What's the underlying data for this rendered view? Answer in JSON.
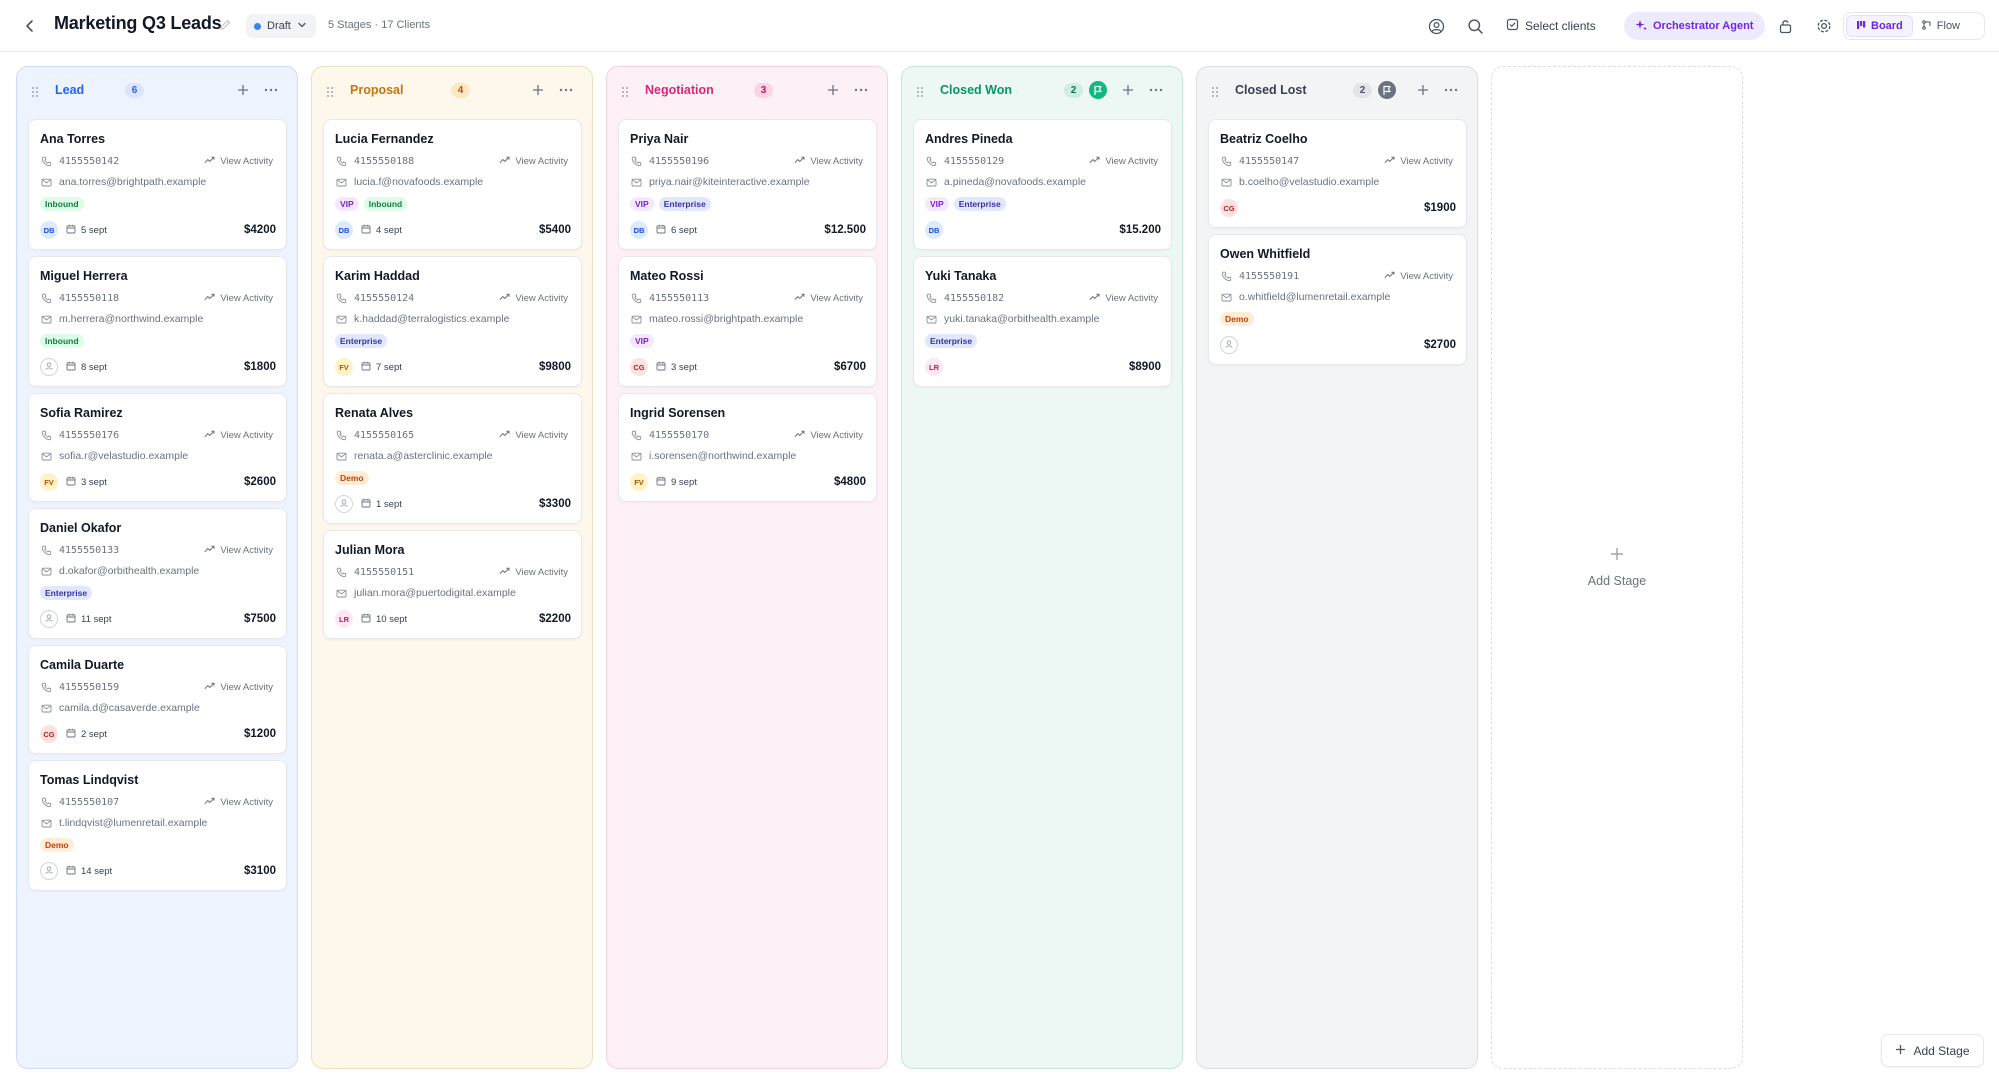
{
  "header": {
    "title": "Marketing Q3 Leads",
    "status": "Draft",
    "subinfo": "5 Stages · 17 Clients",
    "select_clients": "Select clients",
    "agent_label": "Orchestrator Agent",
    "view_board": "Board",
    "view_flow": "Flow"
  },
  "add_stage": {
    "column_label": "Add Stage",
    "button_label": "Add Stage"
  },
  "colors": {
    "accent": "#6d28d9",
    "lead": "#2563eb",
    "proposal": "#c2770e",
    "negotiation": "#db2777",
    "closed_won": "#059669",
    "closed_lost": "#374151"
  },
  "columns": [
    {
      "name": "Lead",
      "count": "6",
      "cards": [
        {
          "name": "Ana Torres",
          "phone": "4155550142",
          "email": "ana.torres@brightpath.example",
          "tags": [
            "Inbound"
          ],
          "owner": "DB",
          "date": "5 sept",
          "amount": "$4200"
        },
        {
          "name": "Miguel Herrera",
          "phone": "4155550118",
          "email": "m.herrera@northwind.example",
          "tags": [
            "Inbound"
          ],
          "owner": "",
          "date": "8 sept",
          "amount": "$1800"
        },
        {
          "name": "Sofia Ramirez",
          "phone": "4155550176",
          "email": "sofia.r@velastudio.example",
          "tags": [],
          "owner": "FV",
          "date": "3 sept",
          "amount": "$2600"
        },
        {
          "name": "Daniel Okafor",
          "phone": "4155550133",
          "email": "d.okafor@orbithealth.example",
          "tags": [
            "Enterprise"
          ],
          "owner": "",
          "date": "11 sept",
          "amount": "$7500"
        },
        {
          "name": "Camila Duarte",
          "phone": "4155550159",
          "email": "camila.d@casaverde.example",
          "tags": [],
          "owner": "CG",
          "date": "2 sept",
          "amount": "$1200"
        },
        {
          "name": "Tomas Lindqvist",
          "phone": "4155550107",
          "email": "t.lindqvist@lumenretail.example",
          "tags": [
            "Demo"
          ],
          "owner": "",
          "date": "14 sept",
          "amount": "$3100"
        }
      ]
    },
    {
      "name": "Proposal",
      "count": "4",
      "cards": [
        {
          "name": "Lucia Fernandez",
          "phone": "4155550188",
          "email": "lucia.f@novafoods.example",
          "tags": [
            "VIP",
            "Inbound"
          ],
          "owner": "DB",
          "date": "4 sept",
          "amount": "$5400"
        },
        {
          "name": "Karim Haddad",
          "phone": "4155550124",
          "email": "k.haddad@terralogistics.example",
          "tags": [
            "Enterprise"
          ],
          "owner": "FV",
          "date": "7 sept",
          "amount": "$9800"
        },
        {
          "name": "Renata Alves",
          "phone": "4155550165",
          "email": "renata.a@asterclinic.example",
          "tags": [
            "Demo"
          ],
          "owner": "",
          "date": "1 sept",
          "amount": "$3300"
        },
        {
          "name": "Julian Mora",
          "phone": "4155550151",
          "email": "julian.mora@puertodigital.example",
          "tags": [],
          "owner": "LR",
          "date": "10 sept",
          "amount": "$2200"
        }
      ]
    },
    {
      "name": "Negotiation",
      "count": "3",
      "cards": [
        {
          "name": "Priya Nair",
          "phone": "4155550196",
          "email": "priya.nair@kiteinteractive.example",
          "tags": [
            "VIP",
            "Enterprise"
          ],
          "owner": "DB",
          "date": "6 sept",
          "amount": "$12.500"
        },
        {
          "name": "Mateo Rossi",
          "phone": "4155550113",
          "email": "mateo.rossi@brightpath.example",
          "tags": [
            "VIP"
          ],
          "owner": "CG",
          "date": "3 sept",
          "amount": "$6700"
        },
        {
          "name": "Ingrid Sorensen",
          "phone": "4155550170",
          "email": "i.sorensen@northwind.example",
          "tags": [],
          "owner": "FV",
          "date": "9 sept",
          "amount": "$4800"
        }
      ]
    },
    {
      "name": "Closed Won",
      "count": "2",
      "cards": [
        {
          "name": "Andres Pineda",
          "phone": "4155550129",
          "email": "a.pineda@novafoods.example",
          "tags": [
            "VIP",
            "Enterprise"
          ],
          "owner": "DB",
          "date": "",
          "amount": "$15.200"
        },
        {
          "name": "Yuki Tanaka",
          "phone": "4155550182",
          "email": "yuki.tanaka@orbithealth.example",
          "tags": [
            "Enterprise"
          ],
          "owner": "LR",
          "date": "",
          "amount": "$8900"
        }
      ]
    },
    {
      "name": "Closed Lost",
      "count": "2",
      "cards": [
        {
          "name": "Beatriz Coelho",
          "phone": "4155550147",
          "email": "b.coelho@velastudio.example",
          "tags": [],
          "owner": "CG",
          "date": "",
          "amount": "$1900"
        },
        {
          "name": "Owen Whitfield",
          "phone": "4155550191",
          "email": "o.whitfield@lumenretail.example",
          "tags": [
            "Demo"
          ],
          "owner": "",
          "date": "",
          "amount": "$2700"
        }
      ]
    }
  ],
  "card_labels": {
    "view_activity": "View Activity"
  },
  "icons": [
    "back-arrow-icon",
    "pencil-icon",
    "chevron-down-icon",
    "user-circle-icon",
    "search-icon",
    "check-square-icon",
    "sparkles-icon",
    "lock-icon",
    "gear-icon",
    "board-icon",
    "flow-icon",
    "drag-handle-icon",
    "plus-icon",
    "more-horizontal-icon",
    "flag-icon",
    "phone-icon",
    "mail-icon",
    "trend-icon",
    "calendar-icon",
    "user-icon"
  ]
}
